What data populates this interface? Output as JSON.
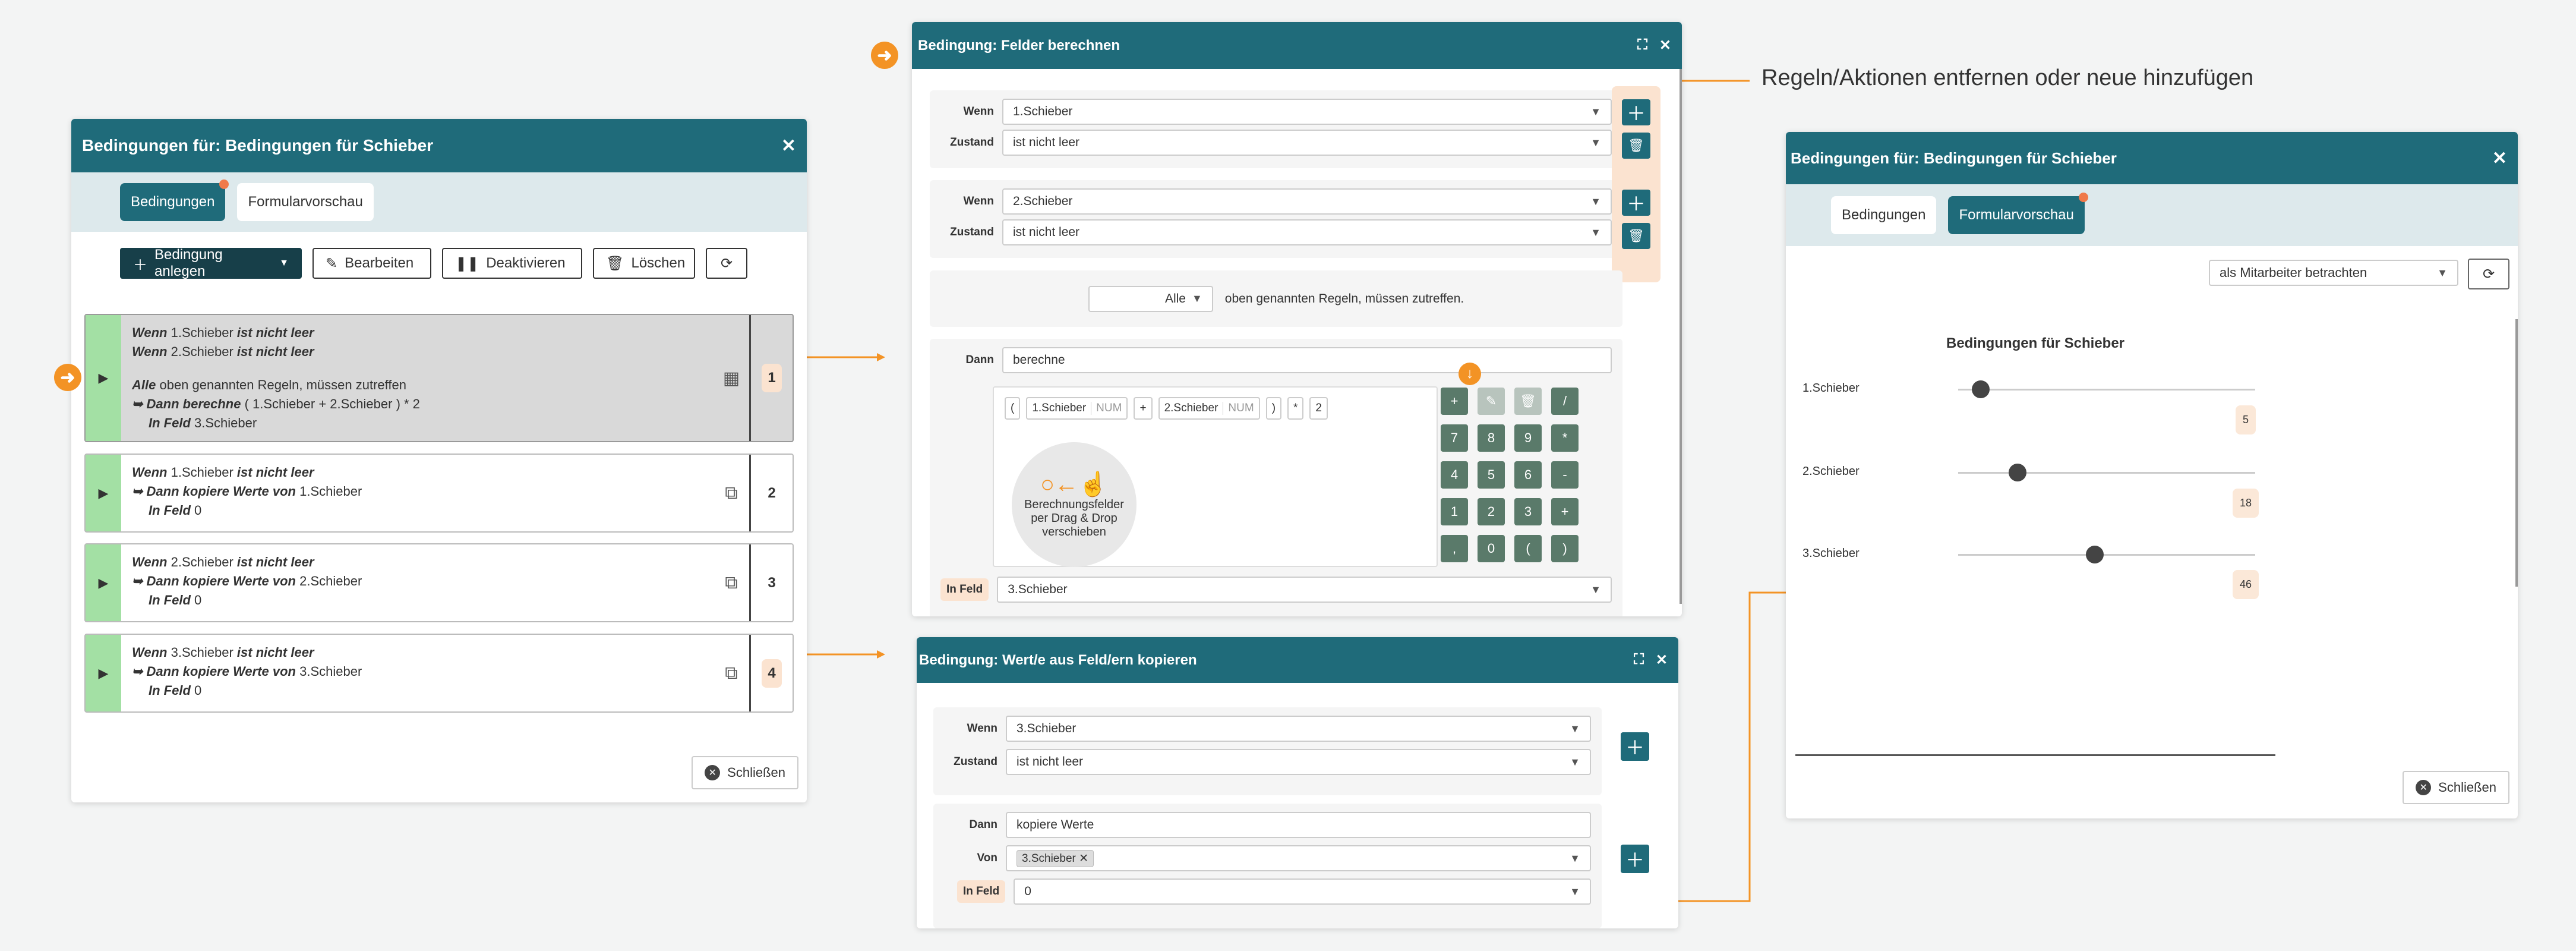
{
  "annotation": {
    "text": "Regeln/Aktionen entfernen oder neue hinzufügen"
  },
  "left": {
    "title": "Bedingungen für: Bedingungen für Schieber",
    "tabs": [
      "Bedingungen",
      "Formularvorschau"
    ],
    "toolbar": {
      "add": "Bedingung anlegen",
      "edit": "Bearbeiten",
      "deactivate": "Deaktivieren",
      "delete": "Löschen"
    },
    "rule1": {
      "wenn": "Wenn",
      "f1": "1.Schieber",
      "f2": "2.Schieber",
      "cond": "ist nicht leer",
      "alle": "Alle",
      "alle_rest": " oben genannten Regeln, müssen zutreffen",
      "dann": "➥ Dann berechne",
      "formula": " ( 1.Schieber + 2.Schieber ) * 2",
      "infeld": "In Feld",
      "target": " 3.Schieber",
      "num": "1"
    },
    "rule2": {
      "field": "1.Schieber",
      "num": "2"
    },
    "rule3": {
      "field": "2.Schieber",
      "num": "3"
    },
    "rule4": {
      "field": "3.Schieber",
      "num": "4"
    },
    "copy_text": "➥ Dann kopiere Werte von",
    "infeld_zero": "0",
    "close": "Schließen"
  },
  "mid_top": {
    "title": "Bedingung: Felder berechnen",
    "wenn": "Wenn",
    "zustand": "Zustand",
    "field1": "1.Schieber",
    "field2": "2.Schieber",
    "cond": "ist nicht leer",
    "alle": "Alle",
    "alle_text": "oben genannten Regeln, müssen zutreffen.",
    "dann": "Dann",
    "dann_val": "berechne",
    "tokens": [
      "(",
      "1.Schieber",
      "NUM",
      "+",
      "2.Schieber",
      "NUM",
      ")",
      "*",
      "2"
    ],
    "drag_text": "Berechnungsfelder per Drag & Drop verschieben",
    "keypad": [
      "+",
      "✎",
      "🗑",
      "/",
      "7",
      "8",
      "9",
      "*",
      "4",
      "5",
      "6",
      "-",
      "1",
      "2",
      "3",
      "+",
      ",",
      "0",
      "(",
      ")"
    ],
    "infeld": "In Feld",
    "infeld_val": "3.Schieber"
  },
  "mid_bottom": {
    "title": "Bedingung: Wert/e aus Feld/ern kopieren",
    "wenn": "Wenn",
    "wenn_val": "3.Schieber",
    "zustand": "Zustand",
    "zustand_val": "ist nicht leer",
    "dann": "Dann",
    "dann_val": "kopiere Werte",
    "von": "Von",
    "von_tag": "3.Schieber",
    "infeld": "In Feld",
    "infeld_val": "0"
  },
  "right": {
    "title": "Bedingungen für: Bedingungen für Schieber",
    "tabs": [
      "Bedingungen",
      "Formularvorschau"
    ],
    "view_select": "als Mitarbeiter betrachten",
    "form_title": "Bedingungen für Schieber",
    "sliders": [
      {
        "label": "1.Schieber",
        "value": "5"
      },
      {
        "label": "2.Schieber",
        "value": "18"
      },
      {
        "label": "3.Schieber",
        "value": "46"
      }
    ],
    "close": "Schließen"
  }
}
